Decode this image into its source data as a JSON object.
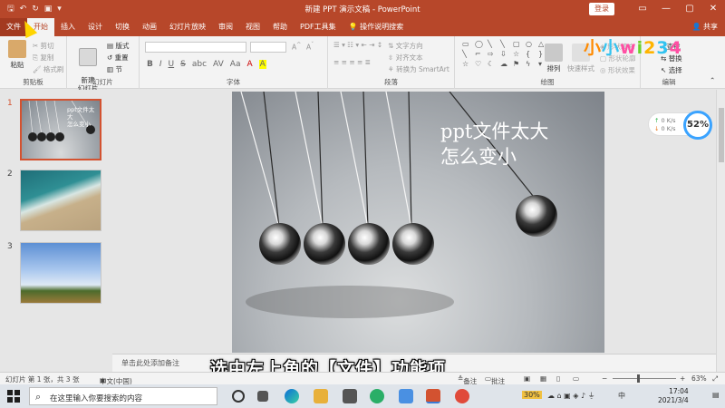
{
  "titlebar": {
    "title": "新建 PPT 演示文稿 - PowerPoint",
    "login": "登录",
    "minimize": "—",
    "restore": "▢",
    "close": "✕"
  },
  "tabs": [
    "文件",
    "开始",
    "插入",
    "设计",
    "切换",
    "动画",
    "幻灯片放映",
    "审阅",
    "视图",
    "帮助",
    "PDF工具集",
    "操作说明搜索"
  ],
  "share_label": "共享",
  "ribbon": {
    "clipboard": {
      "label": "剪贴板",
      "paste": "粘贴",
      "cut": "剪切",
      "copy": "复制",
      "format_painter": "格式刷"
    },
    "slides": {
      "label": "幻灯片",
      "new_slide": "新建\n幻灯片",
      "layout": "版式",
      "reset": "重置",
      "section": "节"
    },
    "font": {
      "label": "字体",
      "buttons": [
        "B",
        "I",
        "U",
        "S",
        "abc",
        "AV",
        "Aa",
        "A",
        "A"
      ]
    },
    "paragraph": {
      "label": "段落",
      "text_direction": "文字方向",
      "align_text": "对齐文本",
      "smartart": "转换为 SmartArt"
    },
    "drawing": {
      "label": "绘图",
      "arrange": "排列",
      "quick_styles": "快速样式",
      "fill": "形状填充",
      "outline": "形状轮廓",
      "effects": "形状效果"
    },
    "editing": {
      "label": "编辑",
      "find": "查找",
      "replace": "替换",
      "select": "选择"
    }
  },
  "logo_chars": [
    "小",
    "小",
    "w",
    "i",
    "2",
    "3",
    "4"
  ],
  "thumbnails": [
    {
      "number": "1",
      "text": "ppt文件太大\n怎么变小"
    },
    {
      "number": "2"
    },
    {
      "number": "3"
    }
  ],
  "slide": {
    "title": "ppt文件太大\n怎么变小"
  },
  "notes_placeholder": "单击此处添加备注",
  "speed_widget": {
    "up": "0   K/s",
    "down": "0   K/s",
    "percent": "52%"
  },
  "subtitle": "选中左上角的【文件】功能项",
  "statusbar": {
    "slide_info": "幻灯片 第 1 张，共 3 张",
    "language": "中文(中国)",
    "notes": "备注",
    "comments": "批注",
    "zoom": "63%"
  },
  "taskbar": {
    "search_placeholder": "在这里输入你要搜索的内容",
    "clock_time": "17:04",
    "clock_date": "2021/3/4",
    "battery": "30%",
    "ime": "中"
  },
  "colors": {
    "accent": "#b7472a",
    "selection": "#d35230"
  }
}
